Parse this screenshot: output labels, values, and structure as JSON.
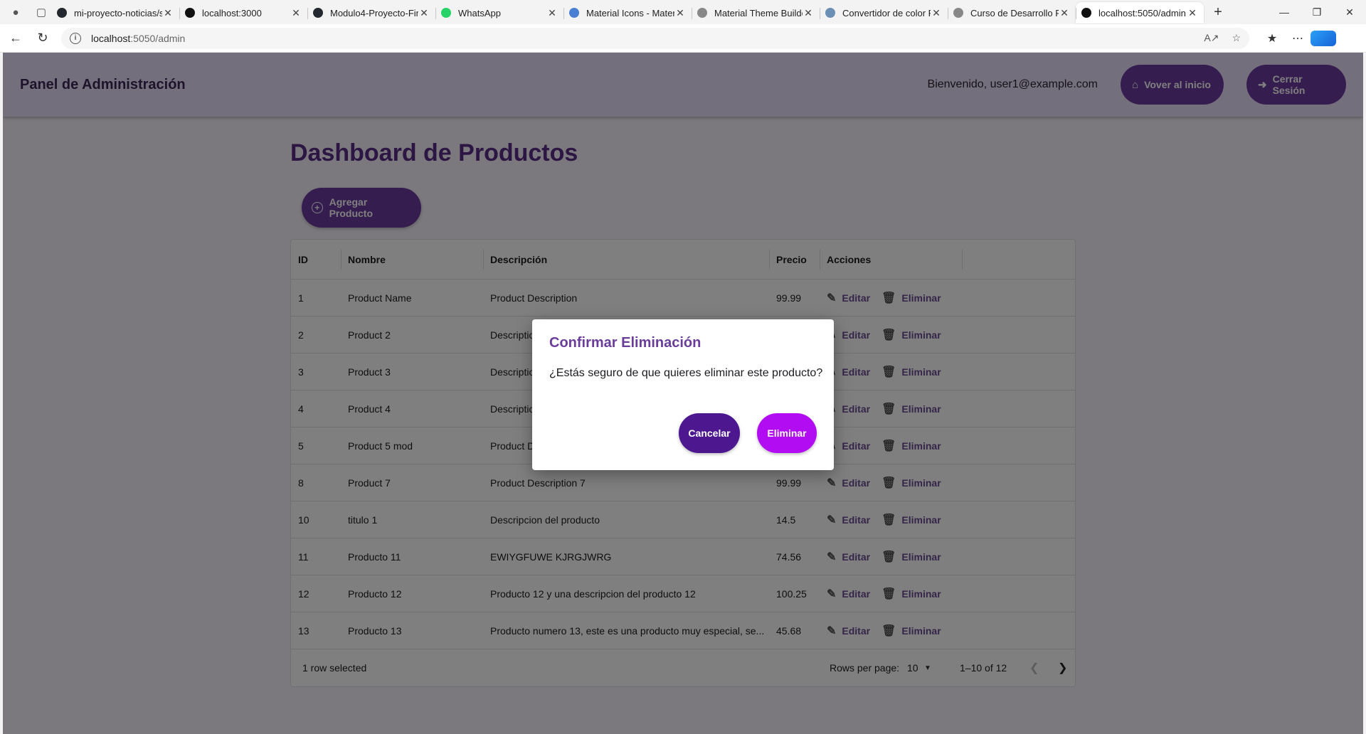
{
  "browser": {
    "tabs": [
      {
        "title": "mi-proyecto-noticias/s",
        "favicon": "github-icon",
        "color": "#24292f"
      },
      {
        "title": "localhost:3000",
        "favicon": "app-icon",
        "color": "#111111"
      },
      {
        "title": "Modulo4-Proyecto-Fin",
        "favicon": "github-icon",
        "color": "#24292f"
      },
      {
        "title": "WhatsApp",
        "favicon": "whatsapp-icon",
        "color": "#25d366"
      },
      {
        "title": "Material Icons - Mater",
        "favicon": "material-icon",
        "color": "#4a7fd4"
      },
      {
        "title": "Material Theme Builde",
        "favicon": "page-icon",
        "color": "#888888"
      },
      {
        "title": "Convertidor de color F",
        "favicon": "converter-icon",
        "color": "#6b8fb5"
      },
      {
        "title": "Curso de Desarrollo F",
        "favicon": "page-icon",
        "color": "#888888"
      },
      {
        "title": "localhost:5050/admin",
        "favicon": "app-icon",
        "color": "#111111",
        "active": true
      }
    ],
    "url_host": "localhost",
    "url_rest": ":5050/admin"
  },
  "header": {
    "brand": "Panel de Administración",
    "welcome": "Bienvenido, user1@example.com",
    "home_label": "Vover al inicio",
    "logout_label": "Cerrar Sesión"
  },
  "main": {
    "title": "Dashboard de Productos",
    "add_label": "Agregar Producto"
  },
  "table": {
    "columns": {
      "id": "ID",
      "name": "Nombre",
      "desc": "Descripción",
      "price": "Precio",
      "actions": "Acciones"
    },
    "edit_label": "Editar",
    "delete_label": "Eliminar",
    "rows": [
      {
        "id": "1",
        "name": "Product Name",
        "desc": "Product Description",
        "price": "99.99"
      },
      {
        "id": "2",
        "name": "Product 2",
        "desc": "Descriptio",
        "price": ""
      },
      {
        "id": "3",
        "name": "Product 3",
        "desc": "Descriptio",
        "price": ""
      },
      {
        "id": "4",
        "name": "Product 4",
        "desc": "Descriptio",
        "price": ""
      },
      {
        "id": "5",
        "name": "Product 5 mod",
        "desc": "Product D",
        "price": ""
      },
      {
        "id": "8",
        "name": "Product 7",
        "desc": "Product Description 7",
        "price": "99.99"
      },
      {
        "id": "10",
        "name": "titulo 1",
        "desc": "Descripcion del producto",
        "price": "14.5"
      },
      {
        "id": "11",
        "name": "Producto 11",
        "desc": "EWIYGFUWE KJRGJWRG",
        "price": "74.56"
      },
      {
        "id": "12",
        "name": "Producto 12",
        "desc": "Producto 12 y una descripcion del producto 12",
        "price": "100.25"
      },
      {
        "id": "13",
        "name": "Producto 13",
        "desc": "Producto numero 13, este es una producto muy especial, se...",
        "price": "45.68"
      }
    ],
    "footer": {
      "selected": "1 row selected",
      "rows_per_page_label": "Rows per page:",
      "rows_per_page_value": "10",
      "range": "1–10 of 12"
    }
  },
  "dialog": {
    "title": "Confirmar Eliminación",
    "message": "¿Estás seguro de que quieres eliminar este producto?",
    "cancel_label": "Cancelar",
    "confirm_label": "Eliminar"
  },
  "colors": {
    "primary": "#6c3aa0",
    "appbar": "#e9def8",
    "cancel": "#4d1790",
    "confirm": "#b20df2"
  }
}
